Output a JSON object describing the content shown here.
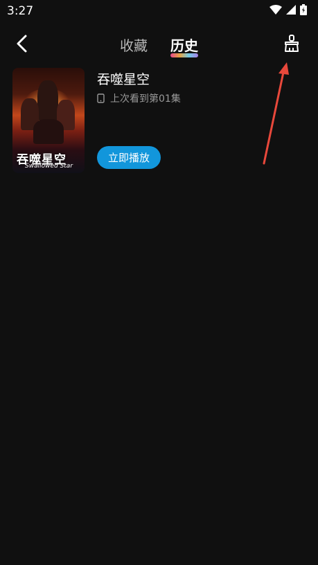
{
  "status_bar": {
    "time": "3:27"
  },
  "nav": {
    "tabs": [
      {
        "label": "收藏",
        "active": false
      },
      {
        "label": "历史",
        "active": true
      }
    ]
  },
  "history": {
    "items": [
      {
        "title": "吞噬星空",
        "progress": "上次看到第01集",
        "play_label": "立即播放",
        "poster_title_cn": "吞噬星空",
        "poster_title_en": "Swallowed Star"
      }
    ]
  },
  "colors": {
    "accent": "#1296db",
    "arrow": "#e8483b",
    "background": "#101010"
  }
}
